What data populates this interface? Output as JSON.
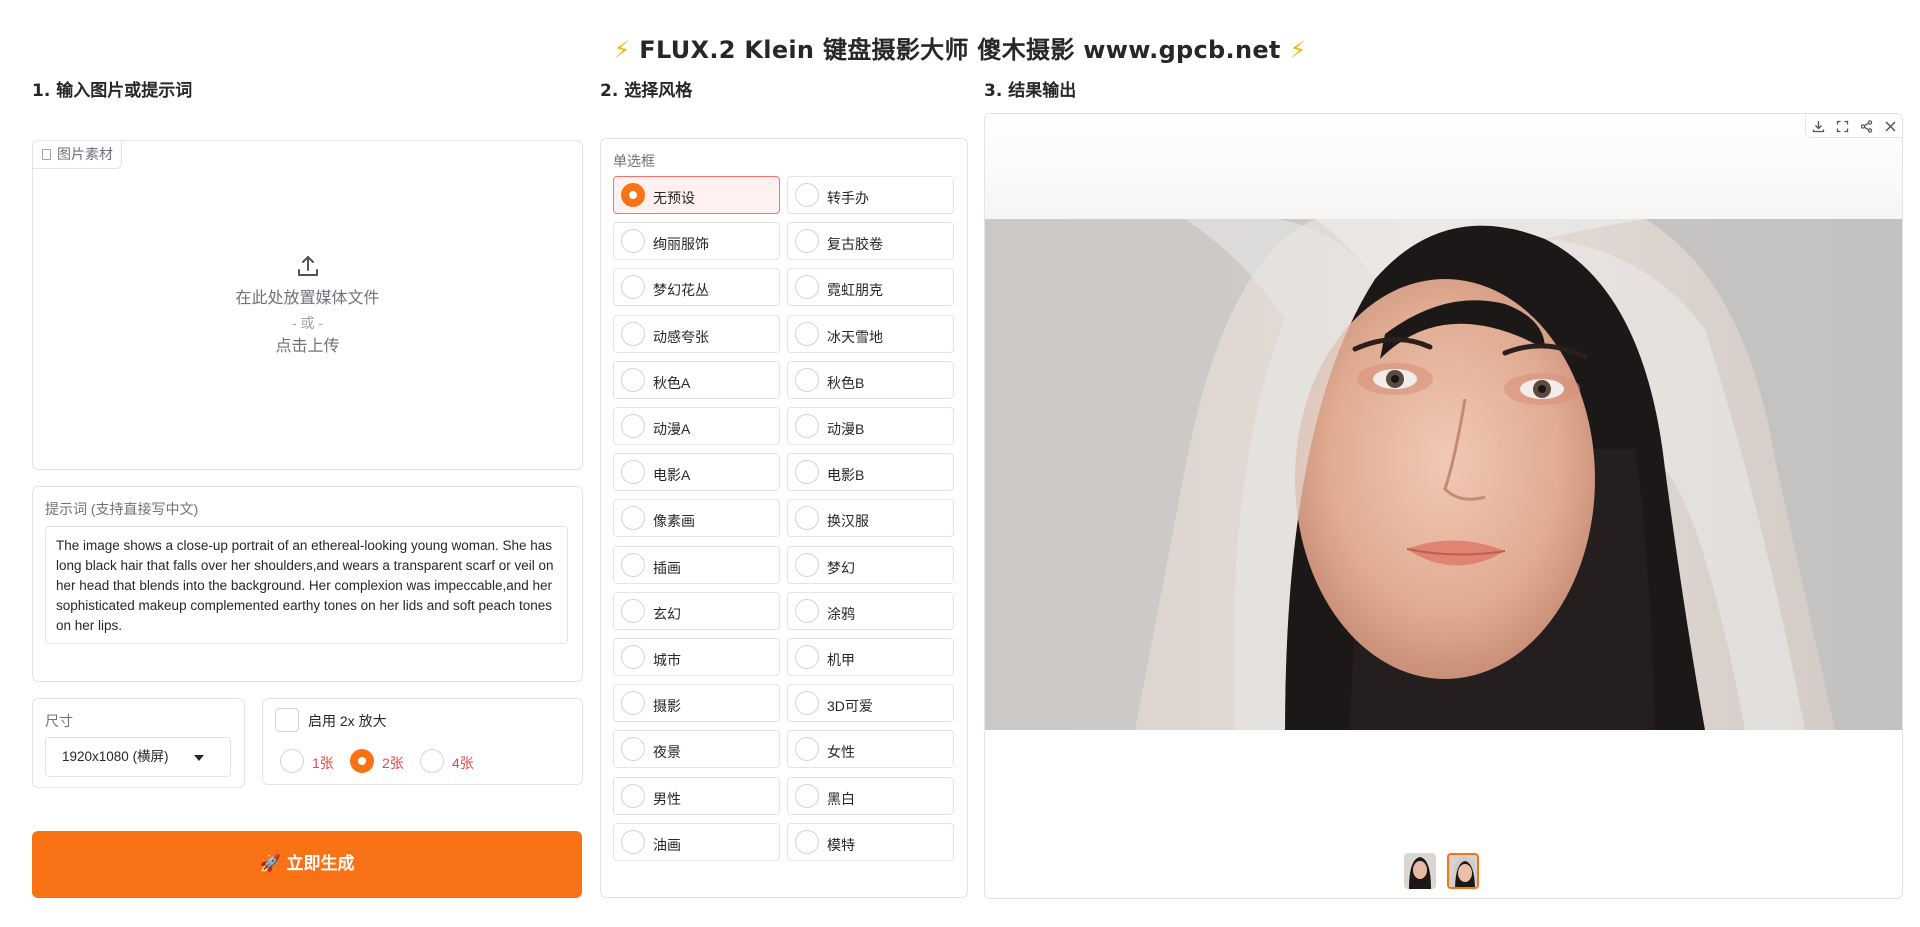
{
  "header": {
    "title": "FLUX.2 Klein 键盘摄影大师 傻木摄影 www.gpcb.net",
    "bolt_color": "#f5b700"
  },
  "columns": {
    "input_title": "1. 输入图片或提示词",
    "style_title": "2. 选择风格",
    "output_title": "3. 结果输出"
  },
  "upload": {
    "tag_label": "图片素材",
    "icon": "upload-icon",
    "drop_text": "在此处放置媒体文件",
    "or_text": "- 或 -",
    "click_text": "点击上传"
  },
  "prompt": {
    "label": "提示词 (支持直接写中文)",
    "value": "The image shows a close-up portrait of an ethereal-looking young woman. She has long black hair that falls over her shoulders,and wears a transparent scarf or veil on her head that blends into the background. Her complexion was impeccable,and her sophisticated makeup complemented earthy tones on her lids and soft peach tones on her lips."
  },
  "size": {
    "label": "尺寸",
    "selected": "1920x1080 (横屏)"
  },
  "upscale": {
    "label": "启用 2x 放大",
    "checked": false
  },
  "count_options": [
    {
      "label": "1张",
      "selected": false
    },
    {
      "label": "2张",
      "selected": true
    },
    {
      "label": "4张",
      "selected": false
    }
  ],
  "generate_button": "🚀 立即生成",
  "styles": {
    "group_label": "单选框",
    "selected": "无预设",
    "options": [
      "无预设",
      "转手办",
      "绚丽服饰",
      "复古胶卷",
      "梦幻花丛",
      "霓虹朋克",
      "动感夸张",
      "冰天雪地",
      "秋色A",
      "秋色B",
      "动漫A",
      "动漫B",
      "电影A",
      "电影B",
      "像素画",
      "换汉服",
      "插画",
      "梦幻",
      "玄幻",
      "涂鸦",
      "城市",
      "机甲",
      "摄影",
      "3D可爱",
      "夜景",
      "女性",
      "男性",
      "黑白",
      "油画",
      "模特"
    ]
  },
  "output": {
    "toolbar": [
      "download-icon",
      "fullscreen-icon",
      "share-icon",
      "close-icon"
    ],
    "thumbnails": [
      {
        "name": "result-thumbnail-1",
        "active": false
      },
      {
        "name": "result-thumbnail-2",
        "active": true
      }
    ]
  },
  "theme": {
    "accent": "#f97316",
    "selected_bg": "#fff1f0",
    "selected_border": "#f87171"
  }
}
